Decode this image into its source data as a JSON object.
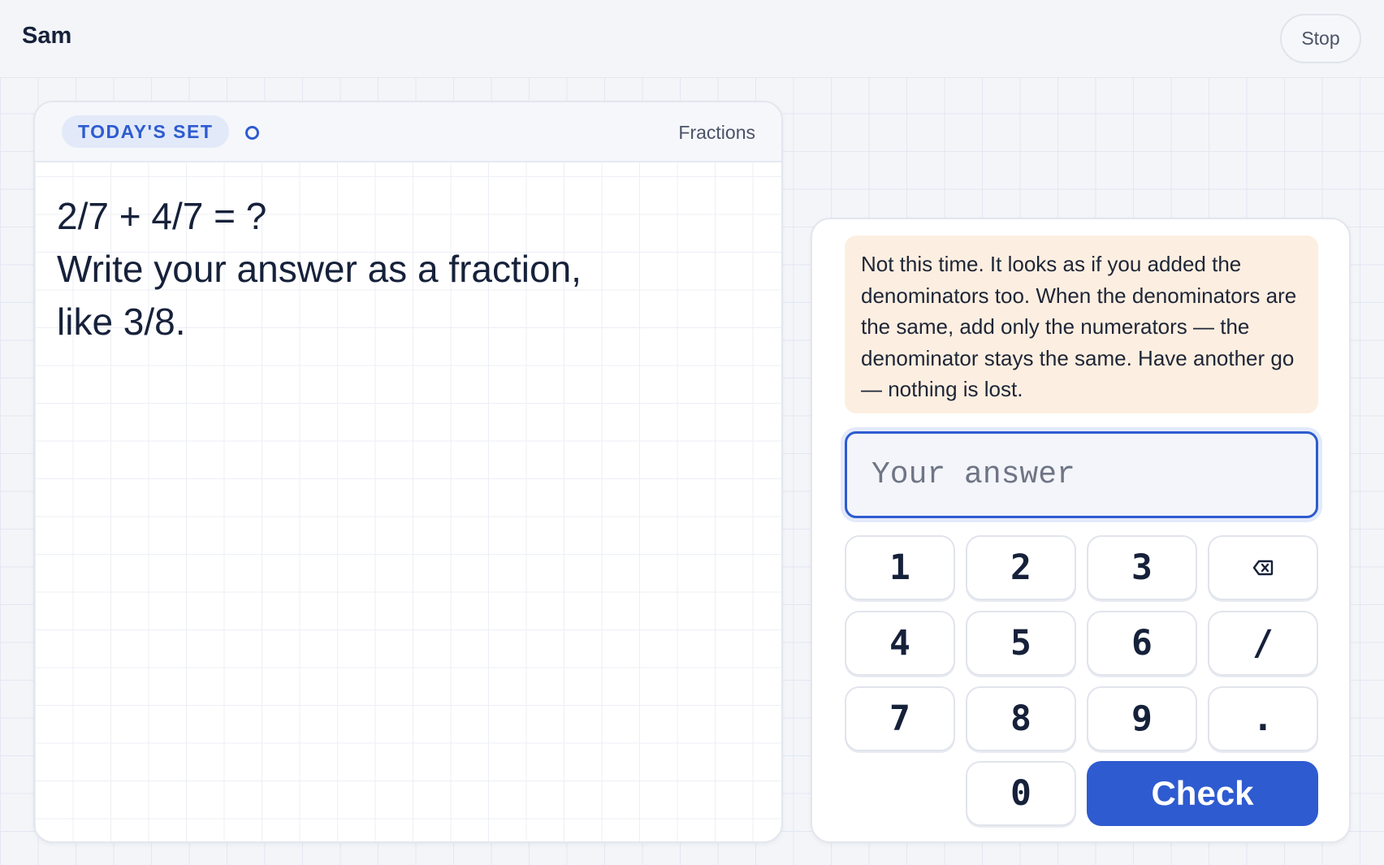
{
  "header": {
    "user_name": "Sam",
    "stop_label": "Stop"
  },
  "problem": {
    "badge": "TODAY'S SET",
    "topic": "Fractions",
    "question_lines": [
      "2/7 + 4/7 = ?",
      "Write your answer as a fraction,",
      "like 3/8."
    ]
  },
  "answer": {
    "feedback": "Not this time. It looks as if you added the denominators too. When the denominators are the same, add only the numerators — the denominator stays the same. Have another go — nothing is lost.",
    "input_placeholder": "Your answer",
    "input_value": "",
    "keypad": {
      "keys": [
        "1",
        "2",
        "3",
        "backspace",
        "4",
        "5",
        "6",
        "/",
        "7",
        "8",
        "9",
        ".",
        "0"
      ],
      "backspace_icon": "backspace-icon"
    },
    "check_label": "Check"
  },
  "colors": {
    "accent": "#2e5bd0",
    "badge_bg": "#e2eaf9",
    "feedback_bg": "#fcefe1",
    "page_bg": "#f3f5f9"
  }
}
